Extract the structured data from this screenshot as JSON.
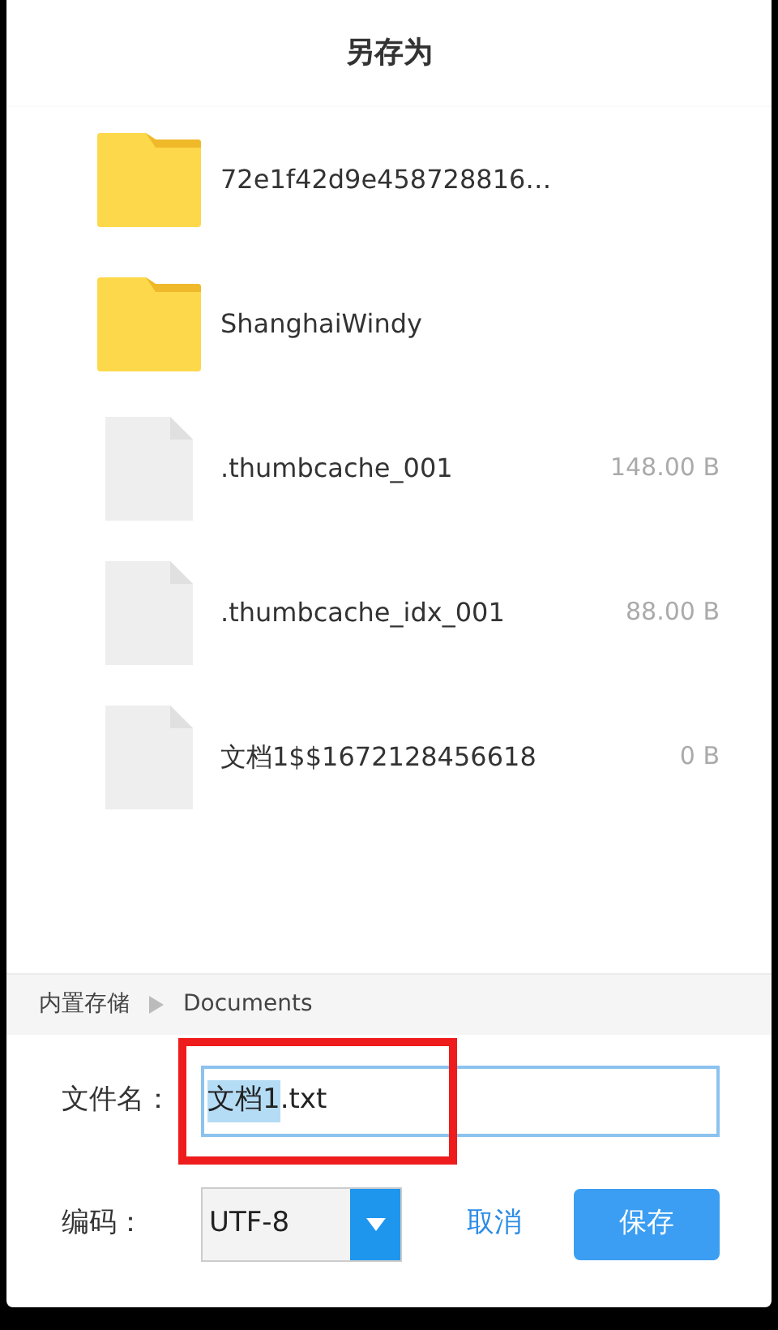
{
  "dialog": {
    "title": "另存为"
  },
  "items": [
    {
      "kind": "folder",
      "name": "72e1f42d9e458728816…"
    },
    {
      "kind": "folder",
      "name": "ShanghaiWindy"
    },
    {
      "kind": "file",
      "name": ".thumbcache_001",
      "size": "148.00 B"
    },
    {
      "kind": "file",
      "name": ".thumbcache_idx_001",
      "size": "88.00 B"
    },
    {
      "kind": "file",
      "name": "文档1$$1672128456618",
      "size": "0 B"
    }
  ],
  "breadcrumb": [
    "内置存储",
    "Documents"
  ],
  "filename": {
    "label": "文件名：",
    "selected_text": "文档1",
    "rest_text": ".txt"
  },
  "encoding": {
    "label": "编码：",
    "value": "UTF-8"
  },
  "buttons": {
    "cancel": "取消",
    "save": "保存"
  },
  "annotation": {
    "kind": "highlight"
  }
}
